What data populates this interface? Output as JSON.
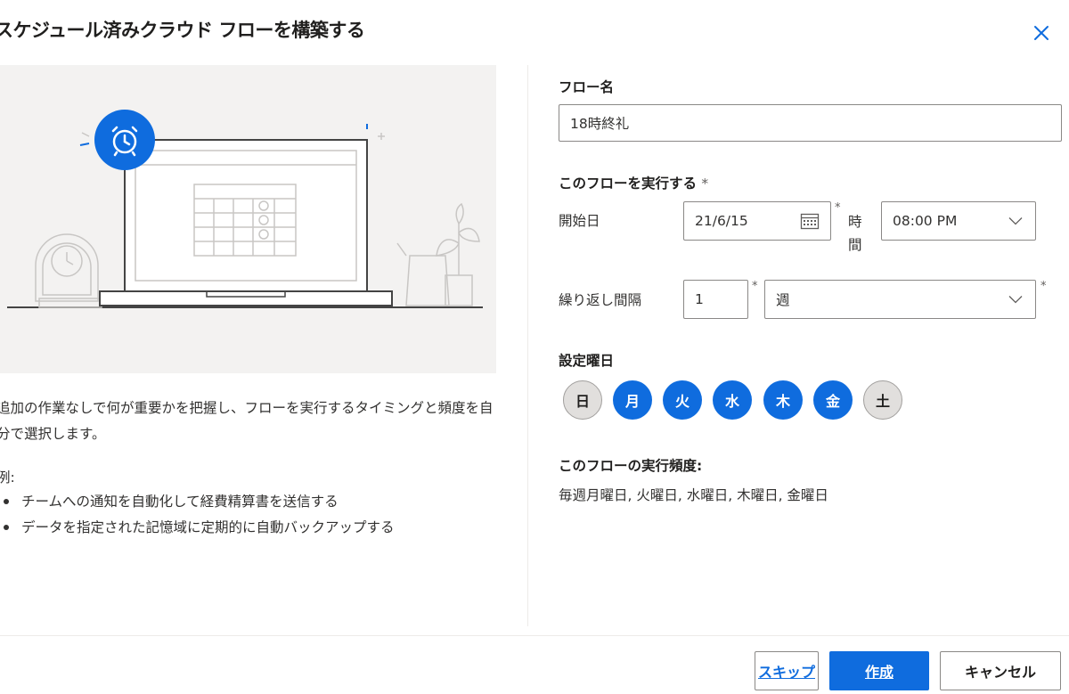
{
  "dialog": {
    "title": "スケジュール済みクラウド フローを構築する",
    "close_icon": "close-icon"
  },
  "left": {
    "description": "追加の作業なしで何が重要かを把握し、フローを実行するタイミングと頻度を自分で選択します。",
    "example_label": "例:",
    "examples": [
      "チームへの通知を自動化して経費精算書を送信する",
      "データを指定された記憶域に定期的に自動バックアップする"
    ]
  },
  "form": {
    "flow_name_label": "フロー名",
    "flow_name_value": "18時終礼",
    "run_label": "このフローを実行する",
    "required_mark": "*",
    "start_date_label": "開始日",
    "start_date_value": "21/6/15",
    "time_label_1": "時",
    "time_label_2": "間",
    "time_value": "08:00 PM",
    "repeat_label": "繰り返し間隔",
    "repeat_interval_value": "1",
    "repeat_unit_value": "週",
    "weekdays_label": "設定曜日",
    "weekdays": [
      {
        "label": "日",
        "selected": false
      },
      {
        "label": "月",
        "selected": true
      },
      {
        "label": "火",
        "selected": true
      },
      {
        "label": "水",
        "selected": true
      },
      {
        "label": "木",
        "selected": true
      },
      {
        "label": "金",
        "selected": true
      },
      {
        "label": "土",
        "selected": false
      }
    ],
    "frequency_label": "このフローの実行頻度:",
    "frequency_value": "毎週月曜日, 火曜日, 水曜日, 木曜日, 金曜日"
  },
  "footer": {
    "skip_label": "スキップ",
    "create_label": "作成",
    "cancel_label": "キャンセル"
  },
  "colors": {
    "accent": "#0f6cde",
    "illustration_bg": "#f3f2f1"
  }
}
